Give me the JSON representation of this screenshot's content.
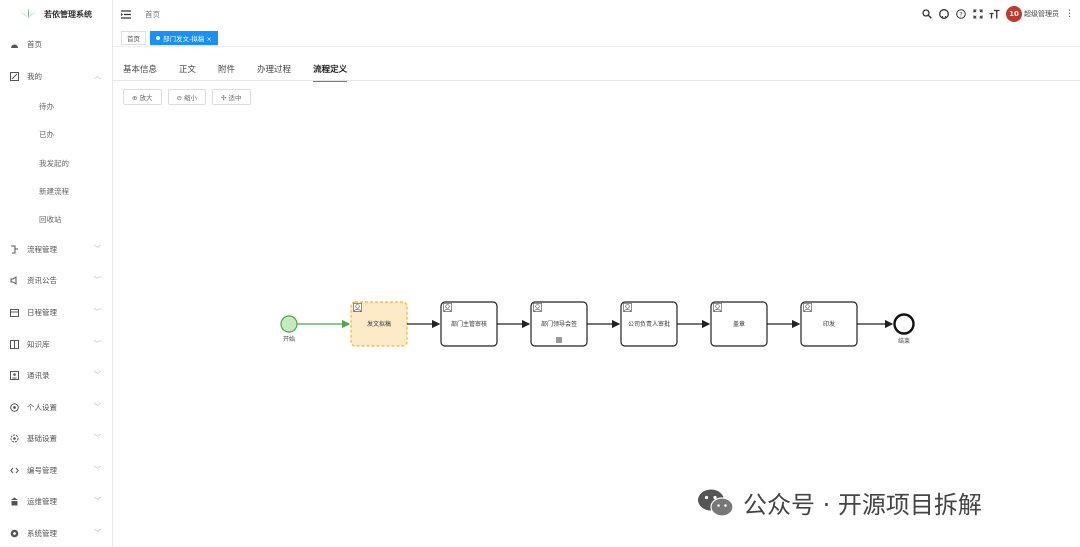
{
  "app": {
    "title": "若依管理系统"
  },
  "header": {
    "breadcrumb": "首页",
    "user_badge": "10",
    "user_name": "超级管理员"
  },
  "tags": [
    {
      "label": "首页"
    },
    {
      "label": "部门发文-拟稿 ×"
    }
  ],
  "sidebar": {
    "items": [
      {
        "label": "首页"
      },
      {
        "label": "我的",
        "chev": "︿"
      },
      {
        "label": "流程管理",
        "chev": "﹀"
      },
      {
        "label": "资讯公告",
        "chev": "﹀"
      },
      {
        "label": "日程管理",
        "chev": "﹀"
      },
      {
        "label": "知识库",
        "chev": "﹀"
      },
      {
        "label": "通讯录",
        "chev": "﹀"
      },
      {
        "label": "个人设置",
        "chev": "﹀"
      },
      {
        "label": "基础设置",
        "chev": "﹀"
      },
      {
        "label": "编号管理",
        "chev": "﹀"
      },
      {
        "label": "运维管理",
        "chev": "﹀"
      },
      {
        "label": "系统管理",
        "chev": "﹀"
      }
    ],
    "subitems": [
      "待办",
      "已办",
      "我发起的",
      "新建流程",
      "回收站"
    ]
  },
  "tabs": [
    "基本信息",
    "正文",
    "附件",
    "办理过程",
    "流程定义"
  ],
  "buttons": {
    "zoom_in": "⊕ 放大",
    "zoom_out": "⊖ 缩小",
    "center": "✣ 适中"
  },
  "flow": {
    "start": "开始",
    "end": "结束",
    "tasks": [
      "发文拟稿",
      "部门主管审核",
      "部门领导会签",
      "公司负责人审批",
      "盖章",
      "印发"
    ]
  },
  "watermark": "公众号 · 开源项目拆解",
  "colors": {
    "accent": "#1890ff",
    "active_task": "#fdebc8",
    "active_border": "#f0b43c",
    "start_fill": "#c8eac0",
    "start_stroke": "#4aa84a"
  }
}
